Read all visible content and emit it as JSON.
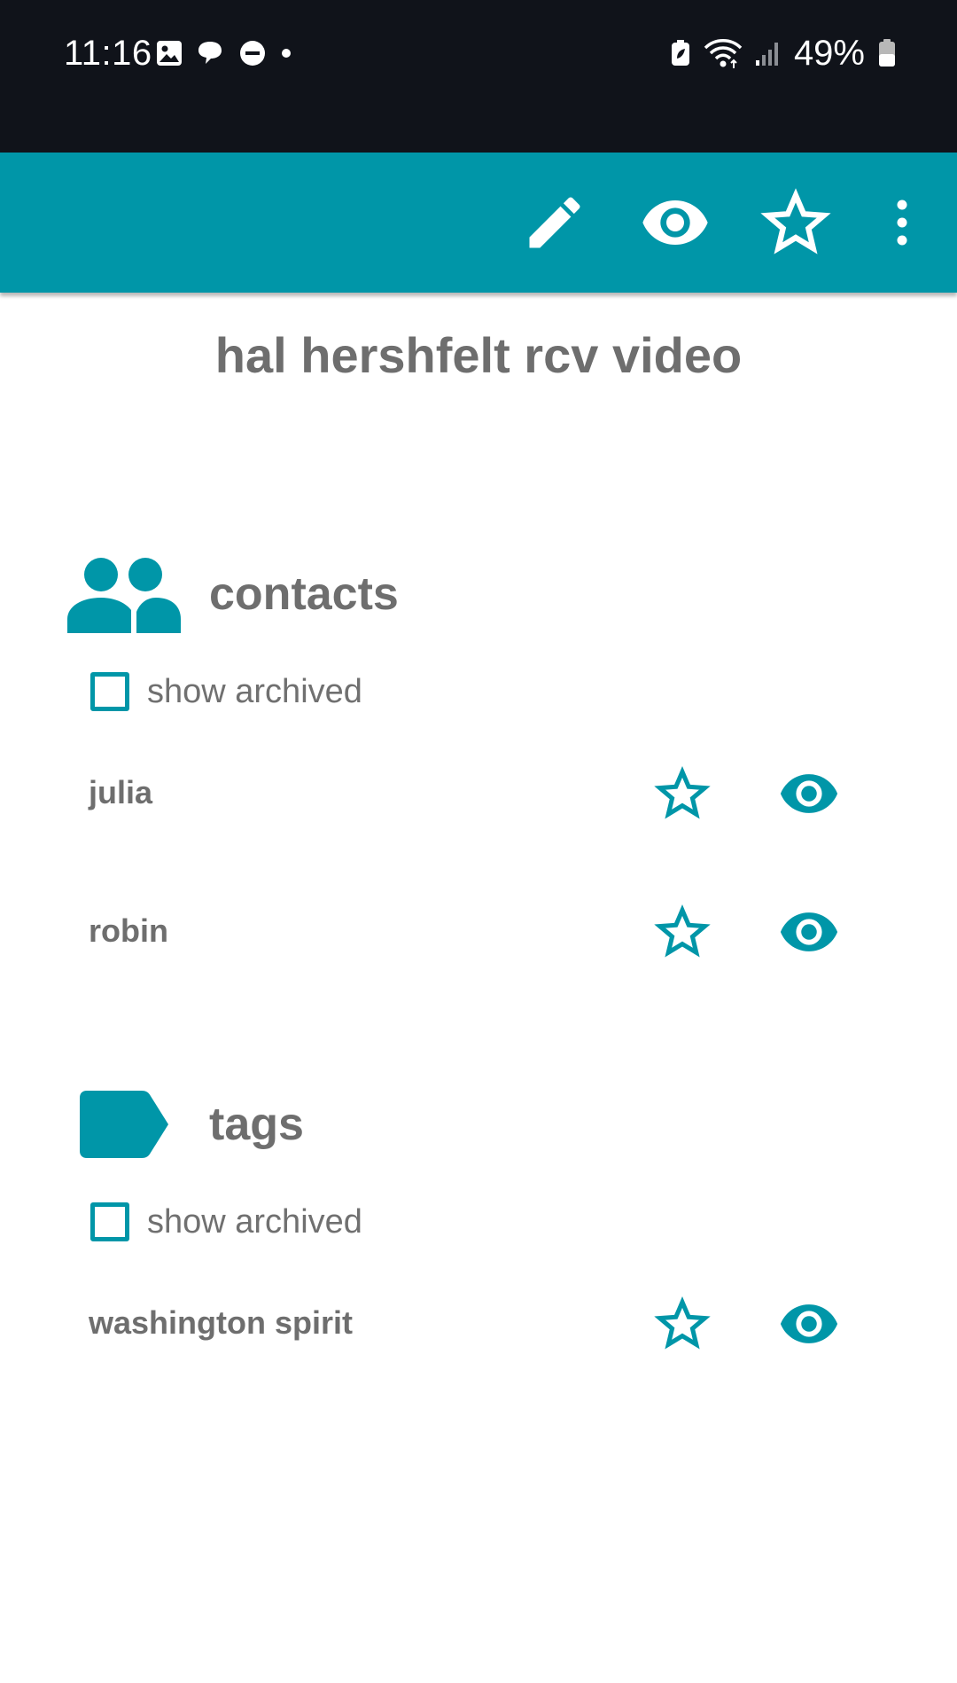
{
  "status_bar": {
    "time": "11:16",
    "battery": "49%",
    "icons_left": [
      "gallery-icon",
      "chat-icon",
      "dnd-icon",
      "dot-icon"
    ],
    "icons_right": [
      "battery-saver-icon",
      "wifi-icon",
      "signal-icon",
      "battery-icon"
    ]
  },
  "app_bar": {
    "actions": [
      "edit-icon",
      "eye-icon",
      "star-outline-icon",
      "more-vert-icon"
    ]
  },
  "page": {
    "title": "hal hershfelt rcv video"
  },
  "contacts": {
    "title": "contacts",
    "icon": "people-icon",
    "show_archived_label": "show archived",
    "show_archived_checked": false,
    "items": [
      {
        "name": "julia"
      },
      {
        "name": "robin"
      }
    ]
  },
  "tags": {
    "title": "tags",
    "icon": "label-icon",
    "show_archived_label": "show archived",
    "show_archived_checked": false,
    "items": [
      {
        "name": "washington spirit"
      }
    ]
  },
  "colors": {
    "accent": "#0096a8",
    "status_bar_bg": "#10131a",
    "text_gray": "#6e6e6e"
  }
}
